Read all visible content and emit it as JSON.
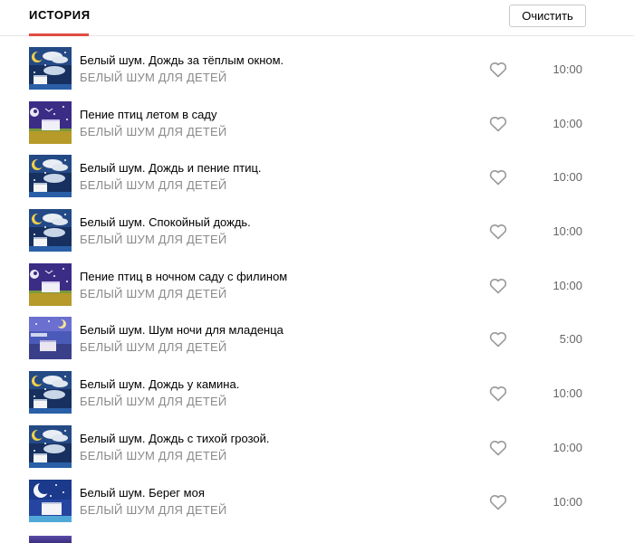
{
  "header": {
    "tab_label": "ИСТОРИЯ",
    "clear_label": "Очистить"
  },
  "tracks": [
    {
      "title": "Белый шум. Дождь за тёплым окном.",
      "artist": "БЕЛЫЙ ШУМ ДЛЯ ДЕТЕЙ",
      "duration": "10:00",
      "cover": "rain-cover"
    },
    {
      "title": "Пение птиц летом в саду",
      "artist": "БЕЛЫЙ ШУМ ДЛЯ ДЕТЕЙ",
      "duration": "10:00",
      "cover": "bird-cover"
    },
    {
      "title": "Белый шум. Дождь и пение птиц.",
      "artist": "БЕЛЫЙ ШУМ ДЛЯ ДЕТЕЙ",
      "duration": "10:00",
      "cover": "rain-cover"
    },
    {
      "title": "Белый шум. Спокойный дождь.",
      "artist": "БЕЛЫЙ ШУМ ДЛЯ ДЕТЕЙ",
      "duration": "10:00",
      "cover": "rain-cover"
    },
    {
      "title": "Пение птиц в ночном саду с филином",
      "artist": "БЕЛЫЙ ШУМ ДЛЯ ДЕТЕЙ",
      "duration": "10:00",
      "cover": "bird-cover"
    },
    {
      "title": "Белый шум. Шум ночи для младенца",
      "artist": "БЕЛЫЙ ШУМ ДЛЯ ДЕТЕЙ",
      "duration": "5:00",
      "cover": "night-cover"
    },
    {
      "title": "Белый шум. Дождь у камина.",
      "artist": "БЕЛЫЙ ШУМ ДЛЯ ДЕТЕЙ",
      "duration": "10:00",
      "cover": "rain-cover"
    },
    {
      "title": "Белый шум. Дождь с тихой грозой.",
      "artist": "БЕЛЫЙ ШУМ ДЛЯ ДЕТЕЙ",
      "duration": "10:00",
      "cover": "rain-cover"
    },
    {
      "title": "Белый шум. Берег моя",
      "artist": "БЕЛЫЙ ШУМ ДЛЯ ДЕТЕЙ",
      "duration": "10:00",
      "cover": "moon-cover"
    }
  ],
  "colors": {
    "accent": "#e24b40",
    "heart": "#9a9a9a",
    "muted_text": "#8a8a8a"
  },
  "icons": {
    "like": "heart-icon"
  }
}
